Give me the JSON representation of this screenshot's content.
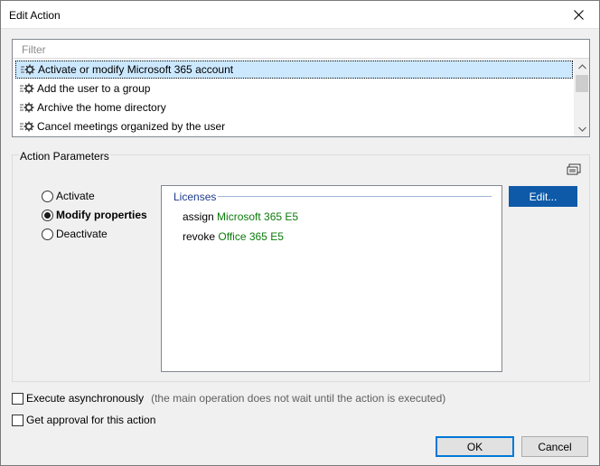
{
  "window": {
    "title": "Edit Action"
  },
  "filter": {
    "placeholder": "Filter",
    "value": ""
  },
  "actions": [
    {
      "label": "Activate or modify Microsoft 365 account",
      "selected": true,
      "icon": "gear-icon"
    },
    {
      "label": "Add the user to a group",
      "selected": false,
      "icon": "gear-icon"
    },
    {
      "label": "Archive the home directory",
      "selected": false,
      "icon": "gear-icon"
    },
    {
      "label": "Cancel meetings organized by the user",
      "selected": false,
      "icon": "gear-icon"
    }
  ],
  "parameters": {
    "group_label": "Action Parameters",
    "options": [
      {
        "label": "Activate",
        "checked": false
      },
      {
        "label": "Modify properties",
        "checked": true
      },
      {
        "label": "Deactivate",
        "checked": false
      }
    ],
    "licenses": {
      "header": "Licenses",
      "rows": [
        {
          "verb": "assign",
          "name": "Microsoft 365 E5"
        },
        {
          "verb": "revoke",
          "name": "Office 365 E5"
        }
      ]
    },
    "edit_label": "Edit..."
  },
  "options": {
    "async_label": "Execute asynchronously",
    "async_hint": "(the main operation does not wait until the action is executed)",
    "async_checked": false,
    "approval_label": "Get approval for this action",
    "approval_checked": false
  },
  "buttons": {
    "ok_label": "OK",
    "cancel_label": "Cancel"
  },
  "colors": {
    "selection": "#cce8ff",
    "license_name": "#0c7a0c",
    "edit_button": "#0f5aa8",
    "licenses_header": "#1e3c8c"
  }
}
